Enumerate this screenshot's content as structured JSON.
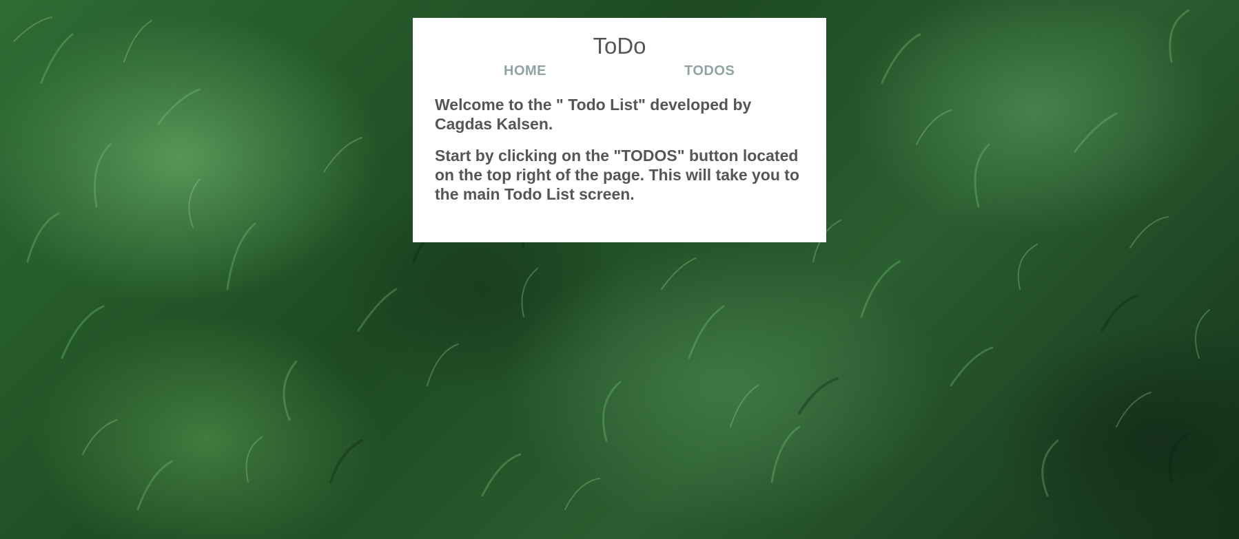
{
  "app": {
    "title": "ToDo"
  },
  "nav": {
    "items": [
      {
        "label": "HOME"
      },
      {
        "label": "TODOS"
      }
    ]
  },
  "content": {
    "welcome": "Welcome to the \" Todo List\" developed by Cagdas Kalsen.",
    "instructions": "Start by clicking on the \"TODOS\" button located on the top right of the page. This will take you to the main Todo List screen."
  },
  "colors": {
    "card_background": "#ffffff",
    "text": "#555555",
    "nav_link": "#8fa3a3",
    "background_grass": "#2f6b33"
  }
}
